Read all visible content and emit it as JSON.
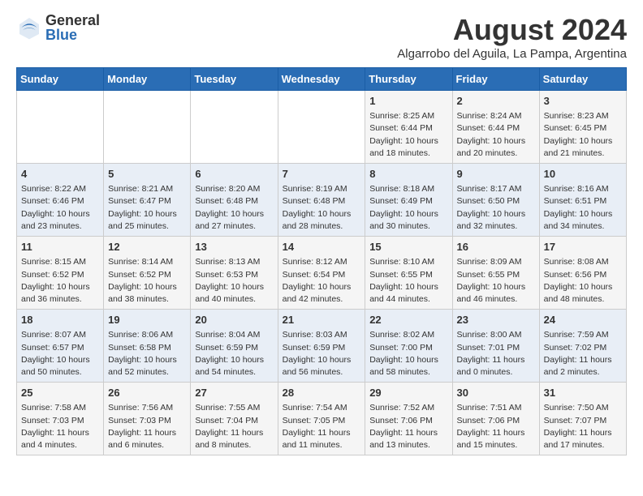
{
  "logo": {
    "general": "General",
    "blue": "Blue"
  },
  "title": {
    "month_year": "August 2024",
    "location": "Algarrobo del Aguila, La Pampa, Argentina"
  },
  "calendar": {
    "headers": [
      "Sunday",
      "Monday",
      "Tuesday",
      "Wednesday",
      "Thursday",
      "Friday",
      "Saturday"
    ],
    "weeks": [
      [
        {
          "day": "",
          "info": ""
        },
        {
          "day": "",
          "info": ""
        },
        {
          "day": "",
          "info": ""
        },
        {
          "day": "",
          "info": ""
        },
        {
          "day": "1",
          "info": "Sunrise: 8:25 AM\nSunset: 6:44 PM\nDaylight: 10 hours\nand 18 minutes."
        },
        {
          "day": "2",
          "info": "Sunrise: 8:24 AM\nSunset: 6:44 PM\nDaylight: 10 hours\nand 20 minutes."
        },
        {
          "day": "3",
          "info": "Sunrise: 8:23 AM\nSunset: 6:45 PM\nDaylight: 10 hours\nand 21 minutes."
        }
      ],
      [
        {
          "day": "4",
          "info": "Sunrise: 8:22 AM\nSunset: 6:46 PM\nDaylight: 10 hours\nand 23 minutes."
        },
        {
          "day": "5",
          "info": "Sunrise: 8:21 AM\nSunset: 6:47 PM\nDaylight: 10 hours\nand 25 minutes."
        },
        {
          "day": "6",
          "info": "Sunrise: 8:20 AM\nSunset: 6:48 PM\nDaylight: 10 hours\nand 27 minutes."
        },
        {
          "day": "7",
          "info": "Sunrise: 8:19 AM\nSunset: 6:48 PM\nDaylight: 10 hours\nand 28 minutes."
        },
        {
          "day": "8",
          "info": "Sunrise: 8:18 AM\nSunset: 6:49 PM\nDaylight: 10 hours\nand 30 minutes."
        },
        {
          "day": "9",
          "info": "Sunrise: 8:17 AM\nSunset: 6:50 PM\nDaylight: 10 hours\nand 32 minutes."
        },
        {
          "day": "10",
          "info": "Sunrise: 8:16 AM\nSunset: 6:51 PM\nDaylight: 10 hours\nand 34 minutes."
        }
      ],
      [
        {
          "day": "11",
          "info": "Sunrise: 8:15 AM\nSunset: 6:52 PM\nDaylight: 10 hours\nand 36 minutes."
        },
        {
          "day": "12",
          "info": "Sunrise: 8:14 AM\nSunset: 6:52 PM\nDaylight: 10 hours\nand 38 minutes."
        },
        {
          "day": "13",
          "info": "Sunrise: 8:13 AM\nSunset: 6:53 PM\nDaylight: 10 hours\nand 40 minutes."
        },
        {
          "day": "14",
          "info": "Sunrise: 8:12 AM\nSunset: 6:54 PM\nDaylight: 10 hours\nand 42 minutes."
        },
        {
          "day": "15",
          "info": "Sunrise: 8:10 AM\nSunset: 6:55 PM\nDaylight: 10 hours\nand 44 minutes."
        },
        {
          "day": "16",
          "info": "Sunrise: 8:09 AM\nSunset: 6:55 PM\nDaylight: 10 hours\nand 46 minutes."
        },
        {
          "day": "17",
          "info": "Sunrise: 8:08 AM\nSunset: 6:56 PM\nDaylight: 10 hours\nand 48 minutes."
        }
      ],
      [
        {
          "day": "18",
          "info": "Sunrise: 8:07 AM\nSunset: 6:57 PM\nDaylight: 10 hours\nand 50 minutes."
        },
        {
          "day": "19",
          "info": "Sunrise: 8:06 AM\nSunset: 6:58 PM\nDaylight: 10 hours\nand 52 minutes."
        },
        {
          "day": "20",
          "info": "Sunrise: 8:04 AM\nSunset: 6:59 PM\nDaylight: 10 hours\nand 54 minutes."
        },
        {
          "day": "21",
          "info": "Sunrise: 8:03 AM\nSunset: 6:59 PM\nDaylight: 10 hours\nand 56 minutes."
        },
        {
          "day": "22",
          "info": "Sunrise: 8:02 AM\nSunset: 7:00 PM\nDaylight: 10 hours\nand 58 minutes."
        },
        {
          "day": "23",
          "info": "Sunrise: 8:00 AM\nSunset: 7:01 PM\nDaylight: 11 hours\nand 0 minutes."
        },
        {
          "day": "24",
          "info": "Sunrise: 7:59 AM\nSunset: 7:02 PM\nDaylight: 11 hours\nand 2 minutes."
        }
      ],
      [
        {
          "day": "25",
          "info": "Sunrise: 7:58 AM\nSunset: 7:03 PM\nDaylight: 11 hours\nand 4 minutes."
        },
        {
          "day": "26",
          "info": "Sunrise: 7:56 AM\nSunset: 7:03 PM\nDaylight: 11 hours\nand 6 minutes."
        },
        {
          "day": "27",
          "info": "Sunrise: 7:55 AM\nSunset: 7:04 PM\nDaylight: 11 hours\nand 8 minutes."
        },
        {
          "day": "28",
          "info": "Sunrise: 7:54 AM\nSunset: 7:05 PM\nDaylight: 11 hours\nand 11 minutes."
        },
        {
          "day": "29",
          "info": "Sunrise: 7:52 AM\nSunset: 7:06 PM\nDaylight: 11 hours\nand 13 minutes."
        },
        {
          "day": "30",
          "info": "Sunrise: 7:51 AM\nSunset: 7:06 PM\nDaylight: 11 hours\nand 15 minutes."
        },
        {
          "day": "31",
          "info": "Sunrise: 7:50 AM\nSunset: 7:07 PM\nDaylight: 11 hours\nand 17 minutes."
        }
      ]
    ]
  }
}
